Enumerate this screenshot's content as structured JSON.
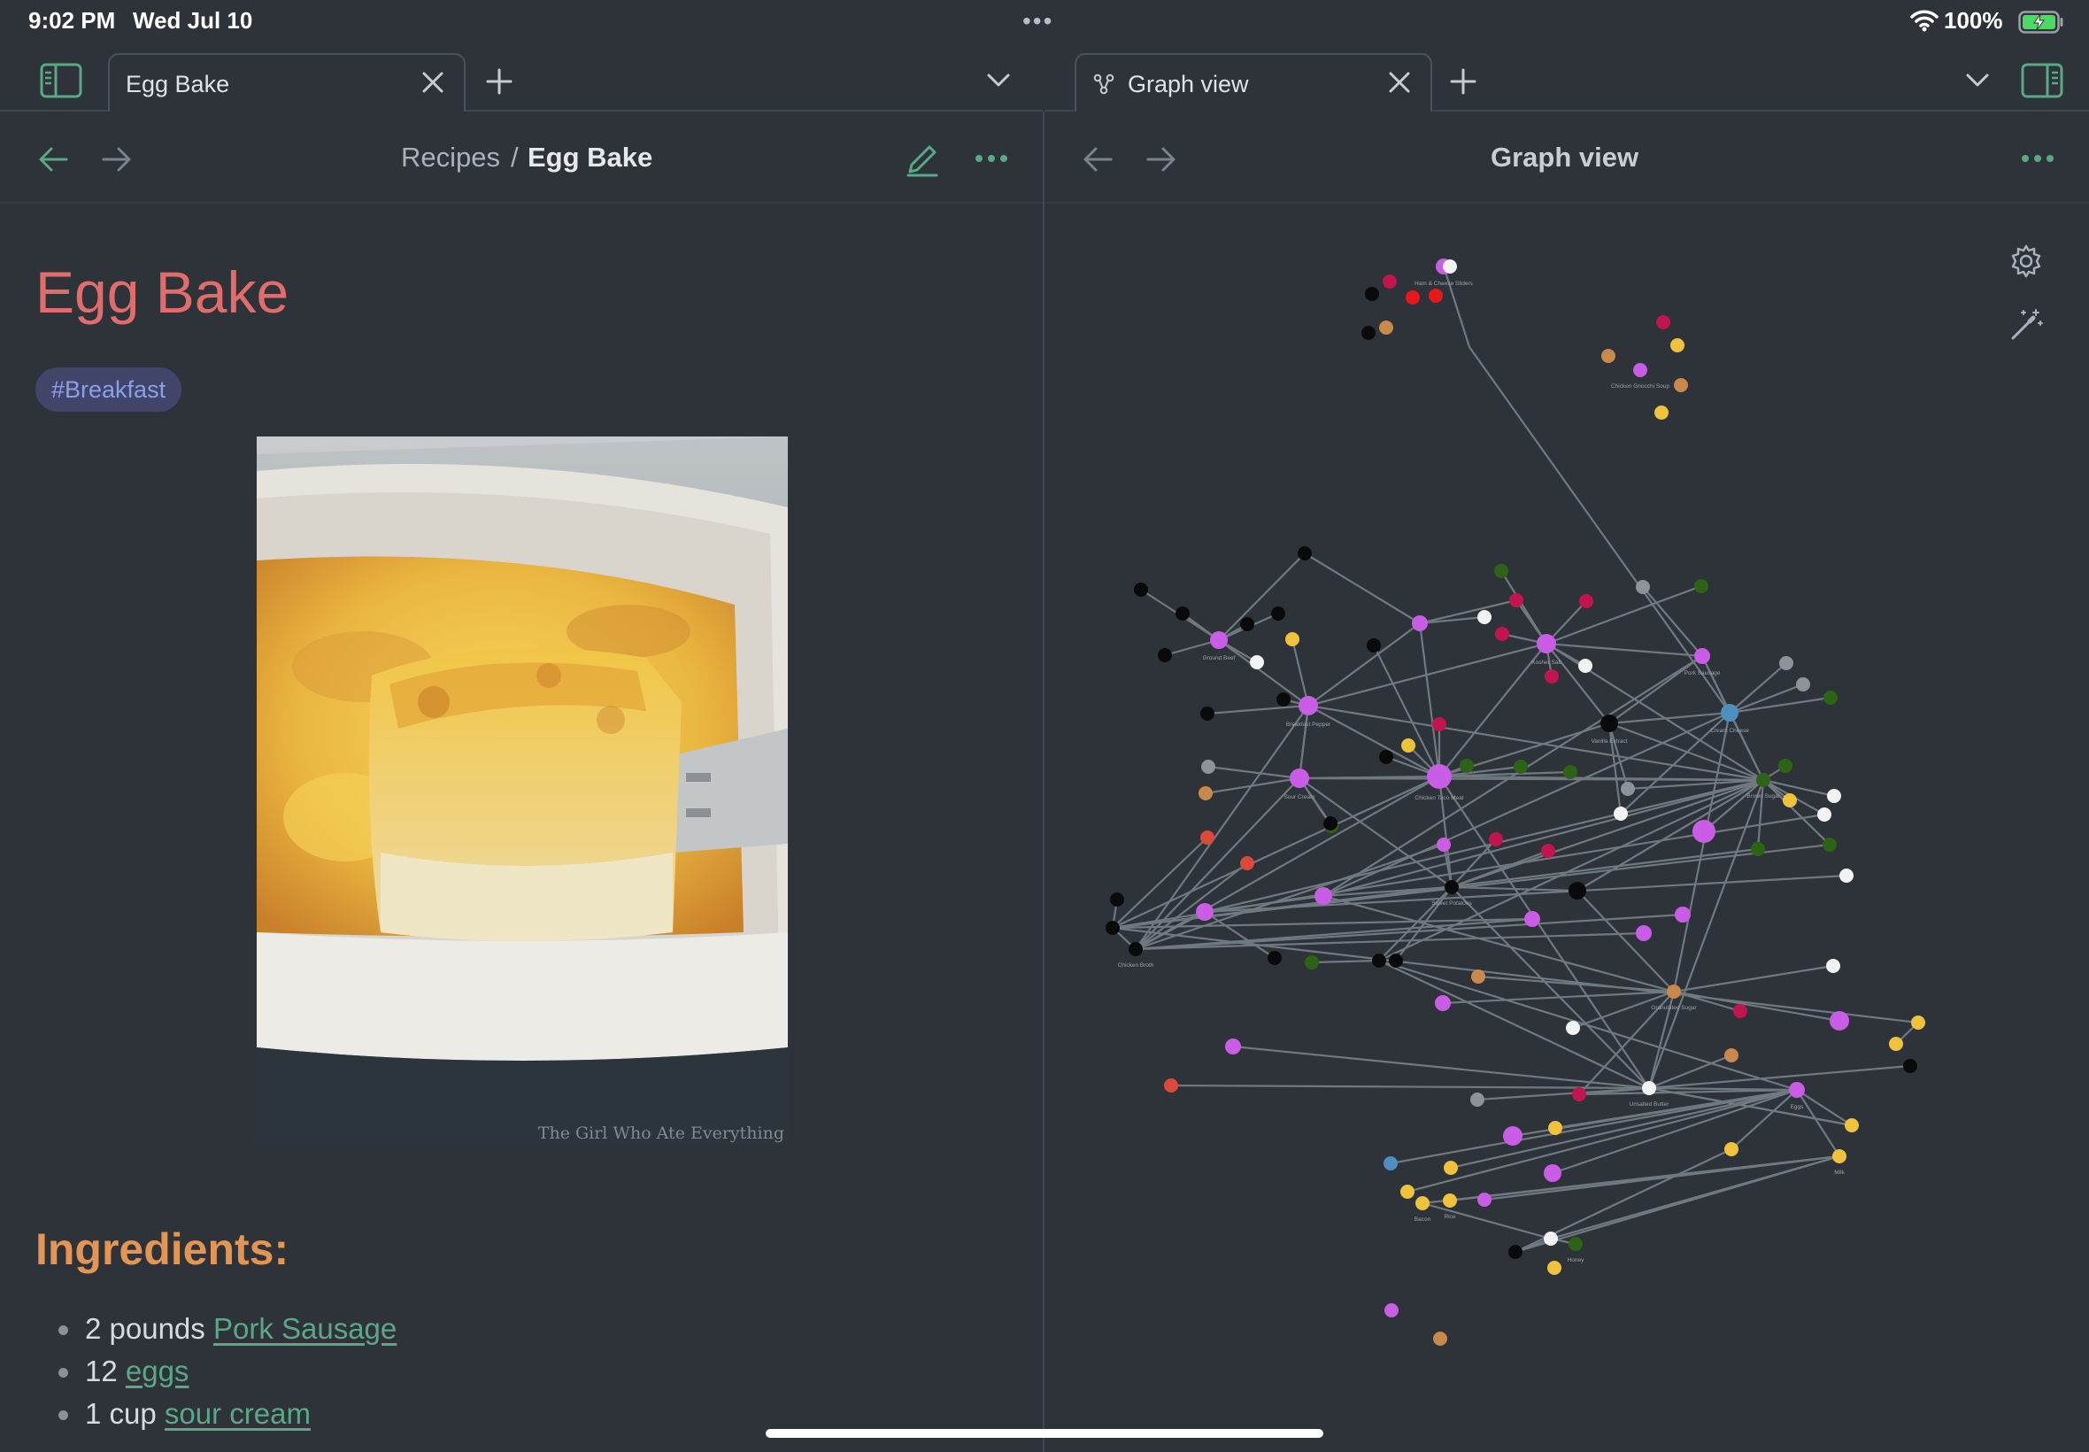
{
  "status_bar": {
    "time": "9:02 PM",
    "date": "Wed Jul 10",
    "battery": "100%",
    "icons": [
      "wifi-icon",
      "battery-charging-icon",
      "multitask-dots-icon"
    ]
  },
  "left_pane": {
    "tab_label": "Egg Bake",
    "breadcrumb_folder": "Recipes",
    "breadcrumb_sep": "/",
    "breadcrumb_note": "Egg Bake"
  },
  "right_pane": {
    "tab_label": "Graph view",
    "title": "Graph view"
  },
  "note": {
    "title": "Egg Bake",
    "tag": "#Breakfast",
    "image_caption": "The Girl Who Ate Everything",
    "section_heading": "Ingredients:",
    "ingredients": [
      {
        "qty": "2 pounds ",
        "item": "Pork Sausage"
      },
      {
        "qty": "12 ",
        "item": "eggs"
      },
      {
        "qty": "1 cup ",
        "item": "sour cream"
      }
    ]
  },
  "colors": {
    "background": "#2e3339",
    "accent_green": "#5aa884",
    "title_red": "#e06c6b",
    "heading_orange": "#e39554",
    "tag_bg": "#404569",
    "graph_edge": "#6f7a80"
  },
  "graph": {
    "labels": [
      "Ham & Cheese Sliders",
      "Chicken Gnocchi Soup",
      "Ground Beef",
      "Breakfast Pepper",
      "Kosher Salt",
      "Pork Sausage",
      "Chicken Taco Meat",
      "Vanilla Extract",
      "Cream Cheese",
      "Sour Cream",
      "Brown Sugar",
      "Chicken Broth",
      "Sweet Potatoes",
      "Granulated Sugar",
      "Unsalted Butter",
      "Eggs",
      "Milk",
      "Bacon",
      "Rice",
      "Honey"
    ]
  }
}
